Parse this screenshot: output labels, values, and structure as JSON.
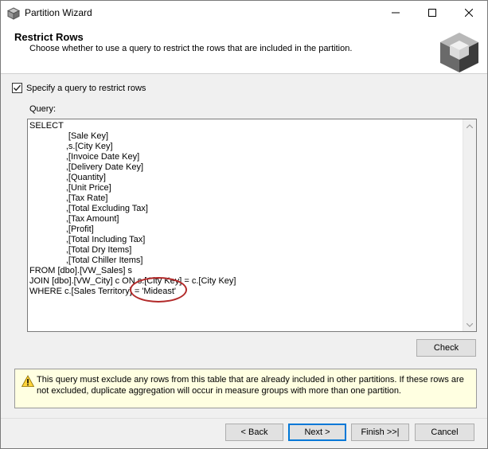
{
  "window": {
    "title": "Partition Wizard",
    "minimize_icon": "minimize-icon",
    "maximize_icon": "maximize-icon",
    "close_icon": "close-icon"
  },
  "header": {
    "title": "Restrict Rows",
    "subtitle": "Choose whether to use a query to restrict the rows that are included in the partition.",
    "icon": "cube-icon"
  },
  "option": {
    "checkbox_label": "Specify a query to restrict rows",
    "checked": true
  },
  "query": {
    "label": "Query:",
    "text": "SELECT\n                [Sale Key]\n               ,s.[City Key]\n               ,[Invoice Date Key]\n               ,[Delivery Date Key]\n               ,[Quantity]\n               ,[Unit Price]\n               ,[Tax Rate]\n               ,[Total Excluding Tax]\n               ,[Tax Amount]\n               ,[Profit]\n               ,[Total Including Tax]\n               ,[Total Dry Items]\n               ,[Total Chiller Items]\nFROM [dbo].[VW_Sales] s\nJOIN [dbo].[VW_City] c ON s.[City Key] = c.[City Key]\nWHERE c.[Sales Territory] = 'Mideast'"
  },
  "check_button": "Check",
  "warning": {
    "icon": "warning-icon",
    "text": "This query must exclude any rows from this table that are already included in other partitions. If these rows are not excluded, duplicate aggregation will occur in measure groups with more than one partition."
  },
  "footer": {
    "back": "< Back",
    "next": "Next >",
    "finish": "Finish >>|",
    "cancel": "Cancel"
  }
}
